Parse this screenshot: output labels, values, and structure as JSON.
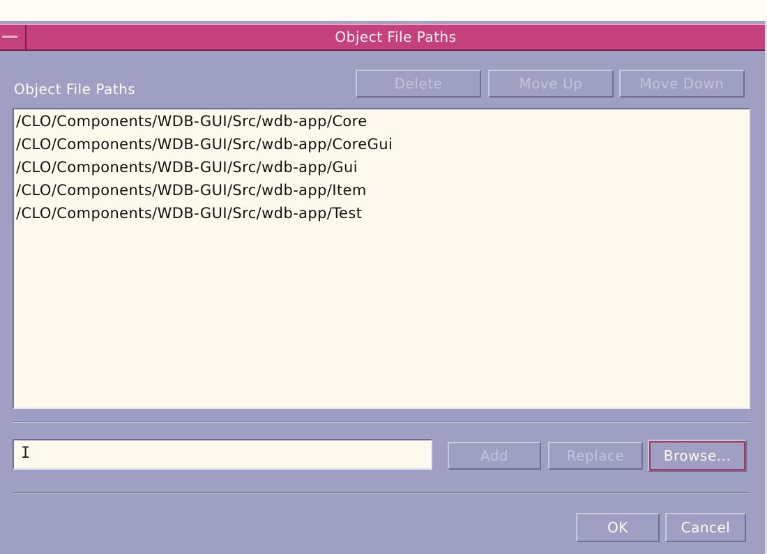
{
  "dialog": {
    "title": "Object File Paths"
  },
  "paths_section": {
    "label": "Object File Paths",
    "buttons": {
      "delete": "Delete",
      "move_up": "Move Up",
      "move_down": "Move Down"
    },
    "items": [
      "/CLO/Components/WDB-GUI/Src/wdb-app/Core",
      "/CLO/Components/WDB-GUI/Src/wdb-app/CoreGui",
      "/CLO/Components/WDB-GUI/Src/wdb-app/Gui",
      "/CLO/Components/WDB-GUI/Src/wdb-app/Item",
      "/CLO/Components/WDB-GUI/Src/wdb-app/Test"
    ]
  },
  "entry": {
    "value": "",
    "buttons": {
      "add": "Add",
      "replace": "Replace",
      "browse": "Browse..."
    }
  },
  "footer": {
    "ok": "OK",
    "cancel": "Cancel"
  },
  "colors": {
    "titlebar": "#c4417e",
    "background": "#9e9fc2",
    "list_background": "#fdf9ec"
  }
}
